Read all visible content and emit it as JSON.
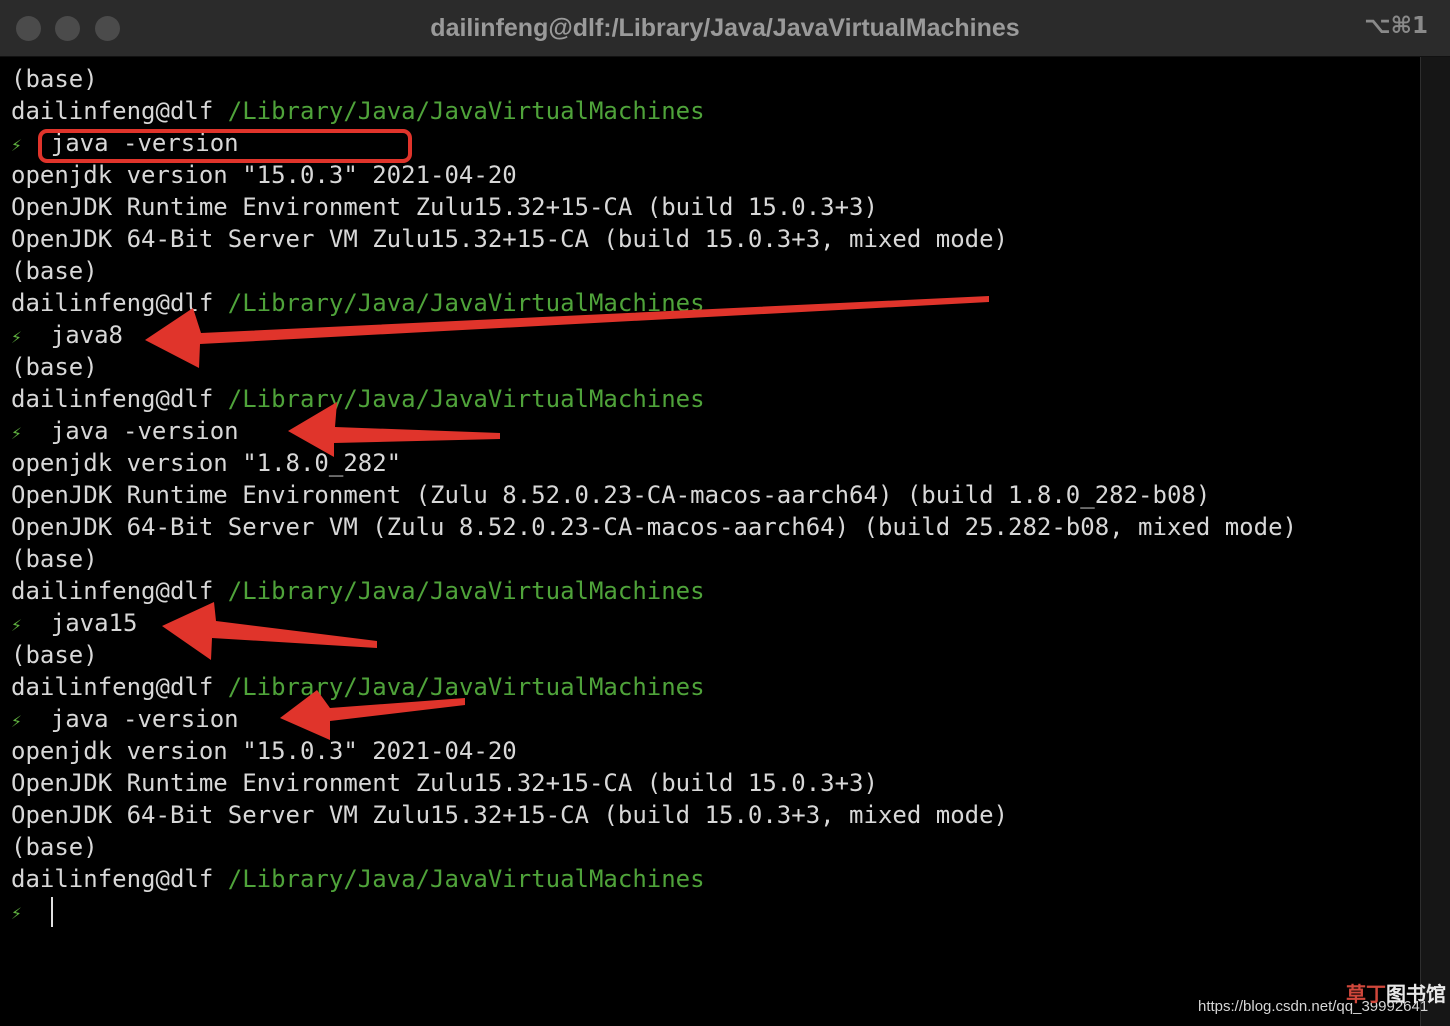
{
  "window": {
    "title": "dailinfeng@dlf:/Library/Java/JavaVirtualMachines",
    "shortcut": "⌥⌘1"
  },
  "terminal": {
    "prompt_user": "dailinfeng@dlf",
    "prompt_path": "/Library/Java/JavaVirtualMachines",
    "prompt_symbol": "⚡",
    "lines": [
      {
        "type": "text",
        "text": "(base)"
      },
      {
        "type": "prompt"
      },
      {
        "type": "cmd",
        "text": "java -version"
      },
      {
        "type": "text",
        "text": "openjdk version \"15.0.3\" 2021-04-20"
      },
      {
        "type": "text",
        "text": "OpenJDK Runtime Environment Zulu15.32+15-CA (build 15.0.3+3)"
      },
      {
        "type": "text",
        "text": "OpenJDK 64-Bit Server VM Zulu15.32+15-CA (build 15.0.3+3, mixed mode)"
      },
      {
        "type": "text",
        "text": "(base)"
      },
      {
        "type": "prompt"
      },
      {
        "type": "cmd",
        "text": "java8"
      },
      {
        "type": "text",
        "text": "(base)"
      },
      {
        "type": "prompt"
      },
      {
        "type": "cmd",
        "text": "java -version"
      },
      {
        "type": "text",
        "text": "openjdk version \"1.8.0_282\""
      },
      {
        "type": "text",
        "text": "OpenJDK Runtime Environment (Zulu 8.52.0.23-CA-macos-aarch64) (build 1.8.0_282-b08)"
      },
      {
        "type": "text",
        "text": "OpenJDK 64-Bit Server VM (Zulu 8.52.0.23-CA-macos-aarch64) (build 25.282-b08, mixed mode)"
      },
      {
        "type": "text",
        "text": "(base)"
      },
      {
        "type": "prompt"
      },
      {
        "type": "cmd",
        "text": "java15"
      },
      {
        "type": "text",
        "text": "(base)"
      },
      {
        "type": "prompt"
      },
      {
        "type": "cmd",
        "text": "java -version"
      },
      {
        "type": "text",
        "text": "openjdk version \"15.0.3\" 2021-04-20"
      },
      {
        "type": "text",
        "text": "OpenJDK Runtime Environment Zulu15.32+15-CA (build 15.0.3+3)"
      },
      {
        "type": "text",
        "text": "OpenJDK 64-Bit Server VM Zulu15.32+15-CA (build 15.0.3+3, mixed mode)"
      },
      {
        "type": "text",
        "text": "(base)"
      },
      {
        "type": "prompt"
      },
      {
        "type": "input",
        "text": ""
      }
    ]
  },
  "annotations": {
    "highlight_color": "#e0342b",
    "arrow_color": "#e0342b"
  },
  "watermark": {
    "url": "https://blog.csdn.net/qq_39992641",
    "logo_red": "草丁",
    "logo_gray": "图书馆"
  }
}
